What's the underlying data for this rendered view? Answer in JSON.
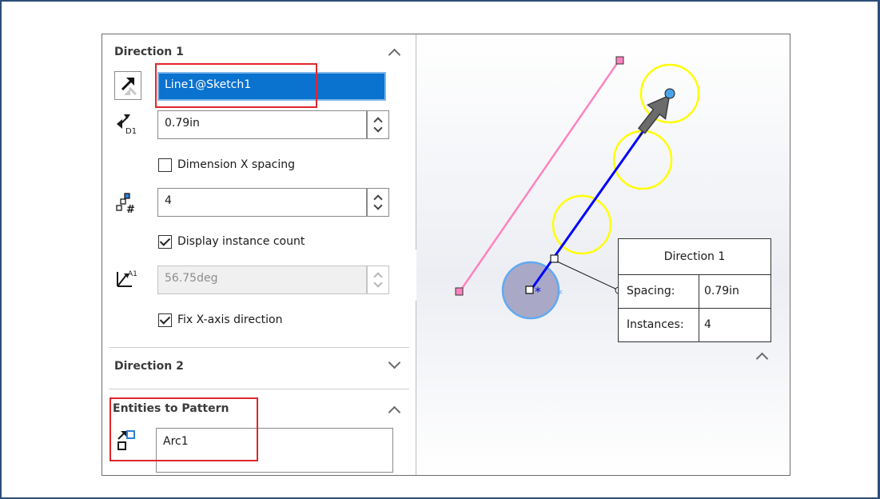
{
  "direction1": {
    "title": "Direction 1",
    "direction_reference": "Line1@Sketch1",
    "spacing": "0.79in",
    "dimension_x_spacing_label": "Dimension X spacing",
    "dimension_x_spacing_checked": false,
    "instances": "4",
    "display_instance_count_label": "Display instance count",
    "display_instance_count_checked": true,
    "angle": "56.75deg",
    "fix_x_axis_label": "Fix X-axis direction",
    "fix_x_axis_checked": true
  },
  "direction2": {
    "title": "Direction 2"
  },
  "entities": {
    "title": "Entities to Pattern",
    "value": "Arc1"
  },
  "callout": {
    "title": "Direction 1",
    "spacing_label": "Spacing:",
    "spacing_value": "0.79in",
    "instances_label": "Instances:",
    "instances_value": "4"
  },
  "icons": {
    "reverse_direction": "reverse-direction-icon",
    "spacing": "spacing-icon",
    "instances": "instances-icon",
    "angle": "angle-icon",
    "entities": "entities-icon"
  },
  "colors": {
    "highlight": "#e0262b",
    "selection": "#0a72cf",
    "pattern_circle": "#ffff00",
    "direction_line": "#0000ff",
    "construction_line": "#ff7fbf"
  }
}
